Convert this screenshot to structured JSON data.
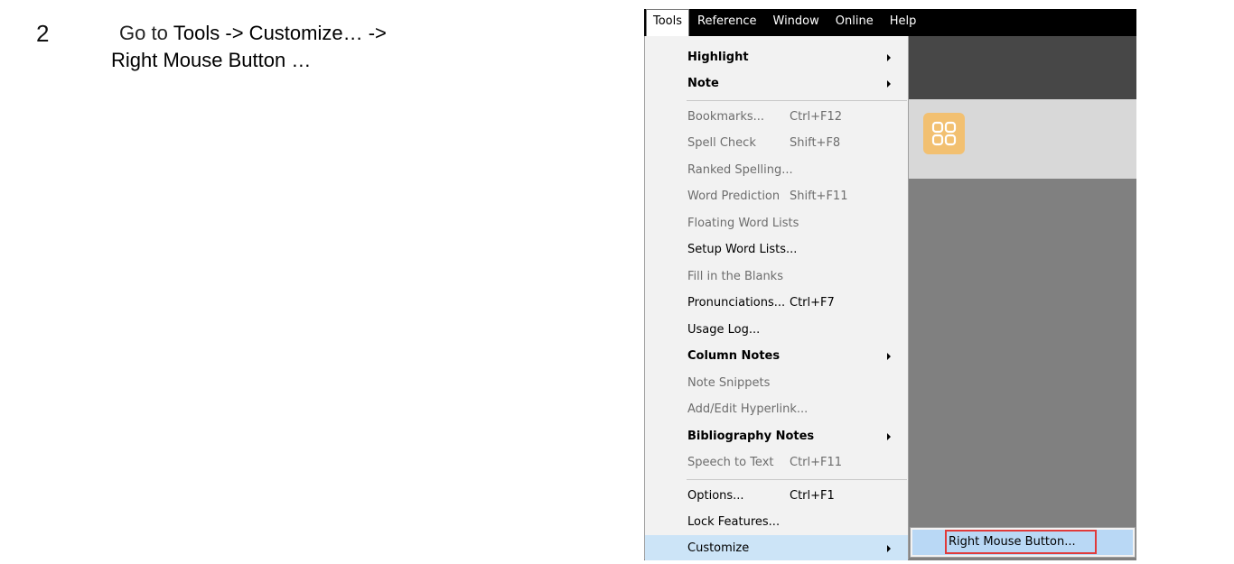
{
  "step": {
    "number": "2"
  },
  "instruction": {
    "prefix": "Go to ",
    "path_part1": "Tools -> Customize… ->",
    "path_part2": "Right Mouse Button …"
  },
  "menubar": {
    "items": [
      "Tools",
      "Reference",
      "Window",
      "Online",
      "Help"
    ],
    "open_menu": "Tools"
  },
  "tools_menu": {
    "items": [
      {
        "label": "Highlight",
        "submenu": true,
        "bold": true
      },
      {
        "label": "Note",
        "submenu": true,
        "bold": true
      },
      {
        "label": "Bookmarks...",
        "shortcut": "Ctrl+F12",
        "disabled": true
      },
      {
        "label": "Spell Check",
        "shortcut": "Shift+F8",
        "disabled": true
      },
      {
        "label": "Ranked Spelling...",
        "disabled": true
      },
      {
        "label": "Word Prediction",
        "shortcut": "Shift+F11",
        "disabled": true
      },
      {
        "label": "Floating Word Lists",
        "disabled": true
      },
      {
        "label": "Setup Word Lists..."
      },
      {
        "label": "Fill in the Blanks",
        "disabled": true
      },
      {
        "label": "Pronunciations...",
        "shortcut": "Ctrl+F7"
      },
      {
        "label": "Usage Log..."
      },
      {
        "label": "Column Notes",
        "submenu": true,
        "bold": true
      },
      {
        "label": "Note Snippets",
        "disabled": true
      },
      {
        "label": "Add/Edit Hyperlink...",
        "disabled": true
      },
      {
        "label": "Bibliography Notes",
        "submenu": true,
        "bold": true
      },
      {
        "label": "Speech to Text",
        "shortcut": "Ctrl+F11",
        "disabled": true
      },
      {
        "label": "Options...",
        "shortcut": "Ctrl+F1"
      },
      {
        "label": "Lock Features..."
      },
      {
        "label": "Customize",
        "submenu": true,
        "highlighted": true
      }
    ]
  },
  "customize_submenu": {
    "items": [
      "Right Mouse Button..."
    ]
  },
  "colors": {
    "menubar_bg": "#000000",
    "menu_bg": "#f2f2f2",
    "highlight": "#cce4f7",
    "callout_red": "#e03a3a",
    "tile_orange": "#f2c071"
  }
}
